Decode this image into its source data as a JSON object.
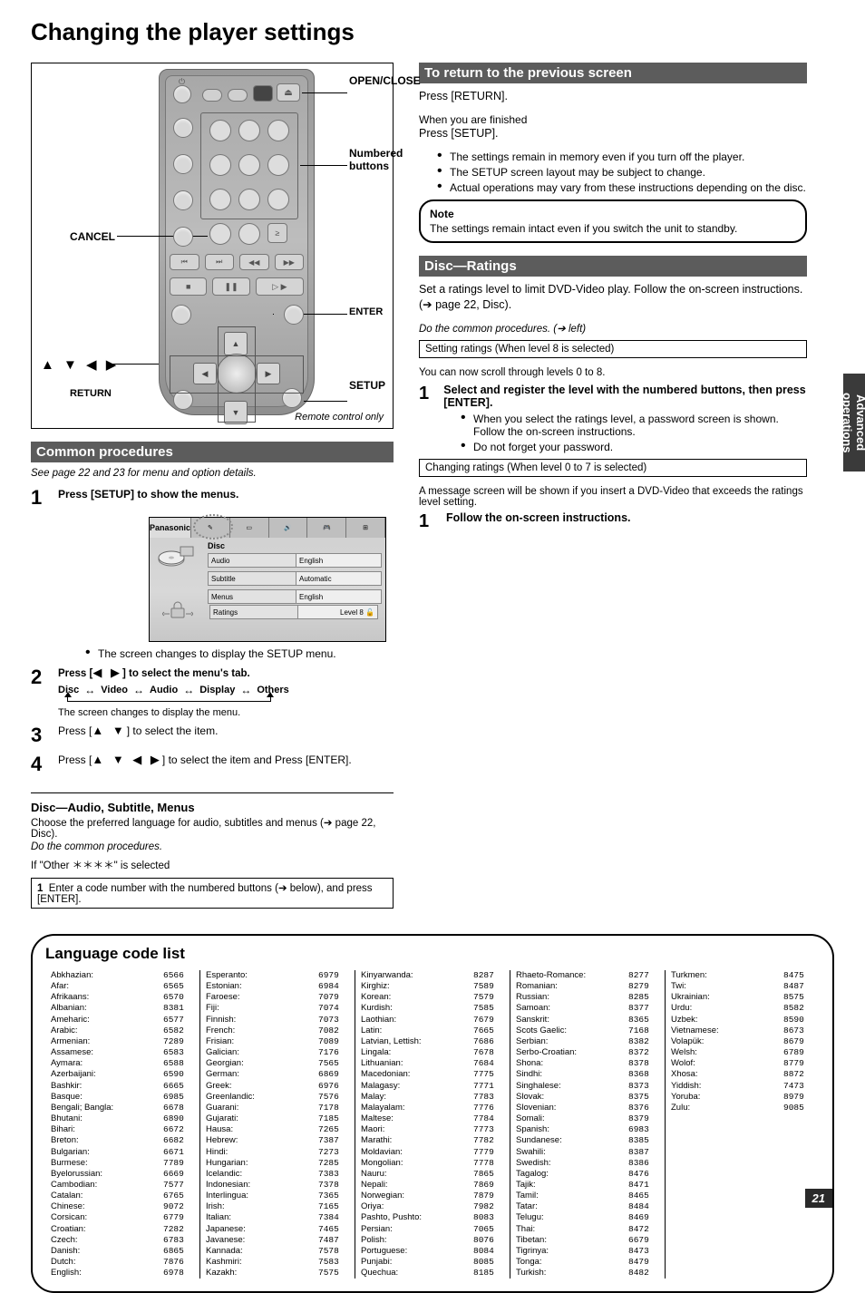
{
  "page_title": "Changing the player settings",
  "side_tab": "Advanced operations",
  "page_number": "21",
  "remote_callouts": {
    "open_close": "OPEN/CLOSE",
    "numbered": "Numbered buttons",
    "cancel": "CANCEL",
    "enter": "ENTER",
    "return": "RETURN",
    "setup": "SETUP",
    "arrows": "▲ ▼ ◀ ▶",
    "remote_only": "Remote control only"
  },
  "common": {
    "common_procedures_title": "Common procedures",
    "intro_italic": "See page 22 and 23 for menu and option details.",
    "step1_bold": "Press [SETUP] to show the menus.",
    "osd": {
      "brand": "Panasonic",
      "tab1": "Disc",
      "tab_icons": [
        "✎",
        "▭",
        "🔊",
        "🎮",
        "⊞"
      ],
      "row1_lbl": "Audio",
      "row1_val": "English",
      "row2_lbl": "Subtitle",
      "row2_val": "Automatic",
      "row3_lbl": "Menus",
      "row3_val": "English",
      "bot_lbl": "Ratings",
      "bot_val": "Level 8"
    },
    "bullet_select_tab": "The screen changes to display the SETUP menu.",
    "step2_pre": "Press [",
    "step2_arrows": "◀ ▶",
    "step2_post": "] to select the menu's tab.",
    "tabs": [
      "Disc",
      "Video",
      "Audio",
      "Display",
      "Others"
    ],
    "tabs_note": "The screen changes to display the menu.",
    "step3_pre": "Press [",
    "step3_arrows": "▲ ▼",
    "step3_post": "] to select the item.",
    "step4_pre": "Press [",
    "step4_arrows": "▲ ▼ ◀ ▶",
    "step4_post": "] to select the item and Press [ENTER].",
    "disc_heading": "Disc—Audio, Subtitle, Menus",
    "disc_text": "Choose the preferred language for audio, subtitles and menus ",
    "disc_link": "(➔ page 22, Disc).",
    "disc_italic": "Do the common procedures.",
    "other_line_pre": "If \"Other ",
    "other_line_code": "＊＊＊＊",
    "other_line_post": "\" is selected",
    "other_box": "Enter a code number with the numbered buttons (➔ below), and press [ENTER]."
  },
  "return": {
    "title": "To return to the previous screen",
    "body_line": "Press [RETURN].",
    "sub_heading": "When you are finished",
    "line2": "Press [SETUP].",
    "bullets": [
      "The settings remain in memory even if you turn off the player.",
      "The SETUP screen layout may be subject to change.",
      "Actual operations may vary from these instructions depending on the disc."
    ],
    "note": "The settings remain intact even if you switch the unit to standby."
  },
  "ratings": {
    "title": "Disc—Ratings",
    "body": "Set a ratings level to limit DVD-Video play. Follow the on-screen instructions. ",
    "body_link": "(➔ page 22, Disc).",
    "ital_pre": "Do the common procedures.",
    "ital_post": " (➔ left)",
    "box": "Setting ratings (When level 8 is selected)",
    "scroll_line": "You can now scroll through levels 0 to 8.",
    "sub": "Select and register the level with the numbered buttons, then press [ENTER].",
    "bullets": [
      "When you select the ratings level, a password screen is shown. Follow the on-screen instructions.",
      "Do not forget your password."
    ],
    "box2": "Changing ratings (When level 0 to 7 is selected)",
    "line_after": "A message screen will be shown if you insert a DVD-Video that exceeds the ratings level setting.",
    "line_after2": "Follow the on-screen instructions."
  },
  "lang_title": "Language code list",
  "lang_cols": [
    [
      [
        "6566",
        "Abkhazian"
      ],
      [
        "6565",
        "Afar"
      ],
      [
        "6570",
        "Afrikaans"
      ],
      [
        "8381",
        "Albanian"
      ],
      [
        "6577",
        "Ameharic"
      ],
      [
        "6582",
        "Arabic"
      ],
      [
        "7289",
        "Armenian"
      ],
      [
        "6583",
        "Assamese"
      ],
      [
        "6588",
        "Aymara"
      ],
      [
        "6590",
        "Azerbaijani"
      ],
      [
        "6665",
        "Bashkir"
      ],
      [
        "6985",
        "Basque"
      ],
      [
        "6678",
        "Bengali; Bangla"
      ],
      [
        "6890",
        "Bhutani"
      ],
      [
        "6672",
        "Bihari"
      ],
      [
        "6682",
        "Breton"
      ],
      [
        "6671",
        "Bulgarian"
      ],
      [
        "7789",
        "Burmese"
      ],
      [
        "6669",
        "Byelorussian"
      ],
      [
        "7577",
        "Cambodian"
      ],
      [
        "6765",
        "Catalan"
      ],
      [
        "9072",
        "Chinese"
      ],
      [
        "6779",
        "Corsican"
      ],
      [
        "7282",
        "Croatian"
      ],
      [
        "6783",
        "Czech"
      ],
      [
        "6865",
        "Danish"
      ],
      [
        "7876",
        "Dutch"
      ],
      [
        "6978",
        "English"
      ]
    ],
    [
      [
        "6979",
        "Esperanto"
      ],
      [
        "6984",
        "Estonian"
      ],
      [
        "7079",
        "Faroese"
      ],
      [
        "7074",
        "Fiji"
      ],
      [
        "7073",
        "Finnish"
      ],
      [
        "7082",
        "French"
      ],
      [
        "7089",
        "Frisian"
      ],
      [
        "7176",
        "Galician"
      ],
      [
        "7565",
        "Georgian"
      ],
      [
        "6869",
        "German"
      ],
      [
        "6976",
        "Greek"
      ],
      [
        "7576",
        "Greenlandic"
      ],
      [
        "7178",
        "Guarani"
      ],
      [
        "7185",
        "Gujarati"
      ],
      [
        "7265",
        "Hausa"
      ],
      [
        "7387",
        "Hebrew"
      ],
      [
        "7273",
        "Hindi"
      ],
      [
        "7285",
        "Hungarian"
      ],
      [
        "7383",
        "Icelandic"
      ],
      [
        "7378",
        "Indonesian"
      ],
      [
        "7365",
        "Interlingua"
      ],
      [
        "7165",
        "Irish"
      ],
      [
        "7384",
        "Italian"
      ],
      [
        "7465",
        "Japanese"
      ],
      [
        "7487",
        "Javanese"
      ],
      [
        "7578",
        "Kannada"
      ],
      [
        "7583",
        "Kashmiri"
      ],
      [
        "7575",
        "Kazakh"
      ]
    ],
    [
      [
        "8287",
        "Kinyarwanda"
      ],
      [
        "7589",
        "Kirghiz"
      ],
      [
        "7579",
        "Korean"
      ],
      [
        "7585",
        "Kurdish"
      ],
      [
        "7679",
        "Laothian"
      ],
      [
        "7665",
        "Latin"
      ],
      [
        "7686",
        "Latvian, Lettish"
      ],
      [
        "7678",
        "Lingala"
      ],
      [
        "7684",
        "Lithuanian"
      ],
      [
        "7775",
        "Macedonian"
      ],
      [
        "7771",
        "Malagasy"
      ],
      [
        "7783",
        "Malay"
      ],
      [
        "7776",
        "Malayalam"
      ],
      [
        "7784",
        "Maltese"
      ],
      [
        "7773",
        "Maori"
      ],
      [
        "7782",
        "Marathi"
      ],
      [
        "7779",
        "Moldavian"
      ],
      [
        "7778",
        "Mongolian"
      ],
      [
        "7865",
        "Nauru"
      ],
      [
        "7869",
        "Nepali"
      ],
      [
        "7879",
        "Norwegian"
      ],
      [
        "7982",
        "Oriya"
      ],
      [
        "8083",
        "Pashto, Pushto"
      ],
      [
        "7065",
        "Persian"
      ],
      [
        "8076",
        "Polish"
      ],
      [
        "8084",
        "Portuguese"
      ],
      [
        "8085",
        "Punjabi"
      ],
      [
        "8185",
        "Quechua"
      ]
    ],
    [
      [
        "8277",
        "Rhaeto-Romance"
      ],
      [
        "8279",
        "Romanian"
      ],
      [
        "8285",
        "Russian"
      ],
      [
        "8377",
        "Samoan"
      ],
      [
        "8365",
        "Sanskrit"
      ],
      [
        "7168",
        "Scots Gaelic"
      ],
      [
        "8382",
        "Serbian"
      ],
      [
        "8372",
        "Serbo-Croatian"
      ],
      [
        "8378",
        "Shona"
      ],
      [
        "8368",
        "Sindhi"
      ],
      [
        "8373",
        "Singhalese"
      ],
      [
        "8375",
        "Slovak"
      ],
      [
        "8376",
        "Slovenian"
      ],
      [
        "8379",
        "Somali"
      ],
      [
        "6983",
        "Spanish"
      ],
      [
        "8385",
        "Sundanese"
      ],
      [
        "8387",
        "Swahili"
      ],
      [
        "8386",
        "Swedish"
      ],
      [
        "8476",
        "Tagalog"
      ],
      [
        "8471",
        "Tajik"
      ],
      [
        "8465",
        "Tamil"
      ],
      [
        "8484",
        "Tatar"
      ],
      [
        "8469",
        "Telugu"
      ],
      [
        "8472",
        "Thai"
      ],
      [
        "6679",
        "Tibetan"
      ],
      [
        "8473",
        "Tigrinya"
      ],
      [
        "8479",
        "Tonga"
      ],
      [
        "8482",
        "Turkish"
      ]
    ],
    [
      [
        "8475",
        "Turkmen"
      ],
      [
        "8487",
        "Twi"
      ],
      [
        "8575",
        "Ukrainian"
      ],
      [
        "8582",
        "Urdu"
      ],
      [
        "8590",
        "Uzbek"
      ],
      [
        "8673",
        "Vietnamese"
      ],
      [
        "8679",
        "Volapük"
      ],
      [
        "6789",
        "Welsh"
      ],
      [
        "8779",
        "Wolof"
      ],
      [
        "8872",
        "Xhosa"
      ],
      [
        "7473",
        "Yiddish"
      ],
      [
        "8979",
        "Yoruba"
      ],
      [
        "9085",
        "Zulu"
      ]
    ]
  ]
}
